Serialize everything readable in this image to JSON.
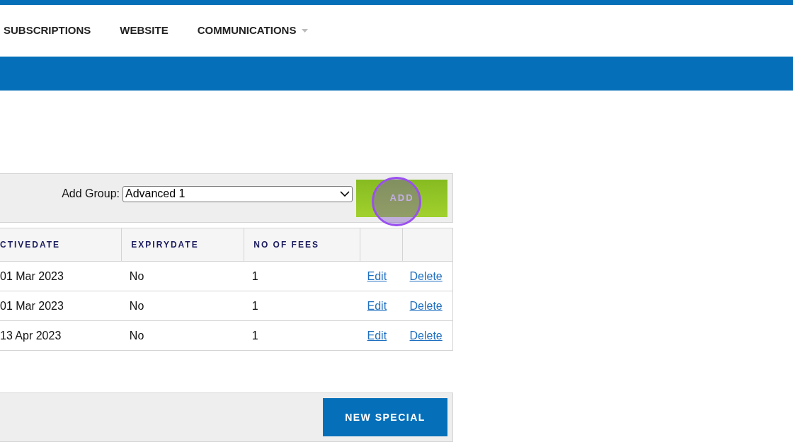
{
  "nav": {
    "items": [
      {
        "label": "SUBSCRIPTIONS",
        "has_menu": false
      },
      {
        "label": "WEBSITE",
        "has_menu": false
      },
      {
        "label": "COMMUNICATIONS",
        "has_menu": true
      }
    ]
  },
  "add_group": {
    "label": "Add Group:",
    "value": "Advanced 1",
    "button": "ADD",
    "click_marker": true
  },
  "table": {
    "columns": [
      "CTIVEDATE",
      "EXPIRYDATE",
      "NO OF FEES"
    ],
    "rows": [
      {
        "cells": [
          "01 Mar 2023",
          "No",
          "1"
        ],
        "edit": "Edit",
        "delete": "Delete"
      },
      {
        "cells": [
          "01 Mar 2023",
          "No",
          "1"
        ],
        "edit": "Edit",
        "delete": "Delete"
      },
      {
        "cells": [
          "13 Apr 2023",
          "No",
          "1"
        ],
        "edit": "Edit",
        "delete": "Delete"
      }
    ]
  },
  "footer": {
    "button": "NEW SPECIAL"
  }
}
